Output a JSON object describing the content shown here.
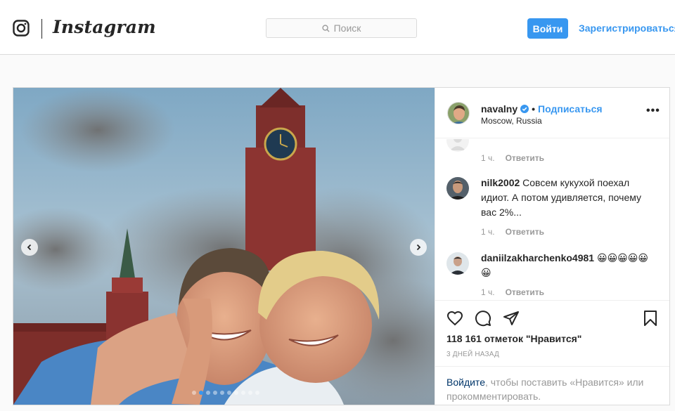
{
  "header": {
    "wordmark": "Instagram",
    "search_placeholder": "Поиск",
    "login_label": "Войти",
    "signup_label": "Зарегистрироваться"
  },
  "post": {
    "username": "navalny",
    "verified": true,
    "bullet": "•",
    "follow_label": "Подписаться",
    "location": "Moscow, Russia",
    "more_label": "•••",
    "image_icons": [
      "chevron-left-icon",
      "chevron-right-icon"
    ],
    "carousel": {
      "total": 10,
      "active_index": 1
    },
    "comments": [
      {
        "username": "",
        "text": "",
        "time": "1 ч.",
        "reply_label": "Ответить"
      },
      {
        "username": "nilk2002",
        "text": "Совсем кукухой поехал идиот. А потом удивляется, почему вас 2%...",
        "time": "1 ч.",
        "reply_label": "Ответить"
      },
      {
        "username": "daniilzakharchenko4981",
        "text": "😀😀😀😀😀😀",
        "time": "1 ч.",
        "reply_label": "Ответить"
      }
    ],
    "action_icons": [
      "heart-icon",
      "comment-icon",
      "share-icon",
      "bookmark-icon"
    ],
    "likes_text": "118 161 отметок \"Нравится\"",
    "timestamp": "3 дней назад",
    "login_prompt": {
      "link_text": "Войдите",
      "rest_text": ", чтобы поставить «Нравится» или прокомментировать."
    }
  },
  "colors": {
    "accent": "#3897f0",
    "border": "#dbdbdb",
    "muted": "#999999",
    "text": "#262626"
  }
}
